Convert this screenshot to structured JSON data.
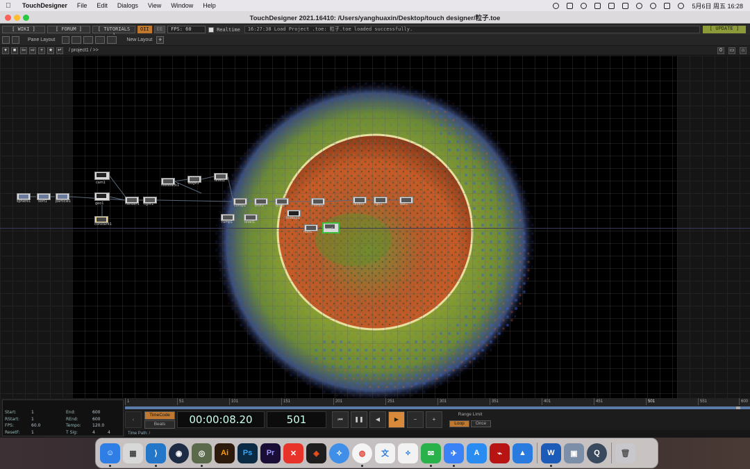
{
  "menubar": {
    "app_name": "TouchDesigner",
    "items": [
      "File",
      "Edit",
      "Dialogs",
      "View",
      "Window",
      "Help"
    ],
    "clock": "5月6日 周五  16:28"
  },
  "window": {
    "title": "TouchDesigner 2021.16410: /Users/yanghuaxin/Desktop/touch designer/粒子.toe"
  },
  "toolbar": {
    "wiki": "[ WIKI ]",
    "forum": "[ FORUM ]",
    "tutorials": "[ TUTORIALS ]",
    "oii": "OII",
    "ee": "EE",
    "fps_label": "FPS:  60",
    "realtime": "Realtime",
    "status_message": "16:27:38 Load Project .toe: 粒子.toe loaded successfully.",
    "update": "[ UPDATE ]",
    "pane_layout": "Pane Layout",
    "new_layout": "New Layout",
    "new_layout_plus": "+"
  },
  "pathbar": {
    "path": "/ project1 / >>",
    "right_value": "0"
  },
  "network": {
    "operators": [
      {
        "label": "sphere1"
      },
      {
        "label": "sort1"
      },
      {
        "label": "particle1"
      },
      {
        "label": "cam1"
      },
      {
        "label": "geo1"
      },
      {
        "label": "constant1"
      },
      {
        "label": "render1"
      },
      {
        "label": "light1"
      },
      {
        "label": "feedback1"
      },
      {
        "label": "edge1"
      },
      {
        "label": "level2"
      },
      {
        "label": "comp1"
      },
      {
        "label": "blur2"
      },
      {
        "label": "blur1"
      },
      {
        "label": "comp2"
      },
      {
        "label": "level1"
      },
      {
        "label": "ramp1"
      },
      {
        "label": "lookup1"
      },
      {
        "label": "null1"
      },
      {
        "label": "over1"
      },
      {
        "label": "level3"
      },
      {
        "label": "rgb1"
      },
      {
        "label": "out1"
      }
    ]
  },
  "timeline": {
    "info": {
      "start_label": "Start:",
      "start": "1",
      "end_label": "End:",
      "end": "600",
      "rstart_label": "RStart:",
      "rstart": "1",
      "rend_label": "REnd:",
      "rend": "600",
      "fps_label": "FPS:",
      "fps": "60.0",
      "tempo_label": "Tempo:",
      "tempo": "120.0",
      "resetf_label": "ResetF:",
      "resetf": "1",
      "tsig_label": "T Sig:",
      "tsig_a": "4",
      "tsig_b": "4"
    },
    "ruler": [
      "1",
      "51",
      "101",
      "151",
      "201",
      "251",
      "301",
      "351",
      "401",
      "451",
      "501",
      "551",
      "600"
    ],
    "timecode_btn": "TimeCode",
    "beats_btn": "Beats",
    "timecode": "00:00:08.20",
    "frame": "501",
    "range_limit": "Range Limit",
    "loop": "Loop",
    "once": "Once",
    "time_path": "Time Path: /"
  },
  "dock": {
    "apps": [
      {
        "name": "finder",
        "color": "#2f7ee6",
        "glyph": "☺"
      },
      {
        "name": "launchpad",
        "color": "#d8d8d8",
        "glyph": "▦"
      },
      {
        "name": "vscode",
        "color": "#2477c8",
        "glyph": "⟩"
      },
      {
        "name": "cinema4d",
        "color": "#1e2b44",
        "glyph": "◉"
      },
      {
        "name": "touchdesigner",
        "color": "#5a6a4a",
        "glyph": "◎"
      },
      {
        "name": "illustrator",
        "color": "#2c1a0c",
        "glyph": "Ai"
      },
      {
        "name": "photoshop",
        "color": "#0b2a44",
        "glyph": "Ps"
      },
      {
        "name": "premiere",
        "color": "#1a0e36",
        "glyph": "Pr"
      },
      {
        "name": "xmind",
        "color": "#e8332b",
        "glyph": "✕"
      },
      {
        "name": "figma",
        "color": "#1e1e1e",
        "glyph": "◈"
      },
      {
        "name": "safari",
        "color": "#3f8fe8",
        "glyph": "✧"
      },
      {
        "name": "chrome",
        "color": "#f4f4f4",
        "glyph": "◍"
      },
      {
        "name": "translator",
        "color": "#f2f2f2",
        "glyph": "文"
      },
      {
        "name": "baidu-netdisk",
        "color": "#f2f2f2",
        "glyph": "⟡"
      },
      {
        "name": "wechat",
        "color": "#2ab24a",
        "glyph": "✉"
      },
      {
        "name": "feishu",
        "color": "#3b82f6",
        "glyph": "✈"
      },
      {
        "name": "app-store",
        "color": "#2a8cf0",
        "glyph": "A"
      },
      {
        "name": "acrobat",
        "color": "#b81414",
        "glyph": "⌁"
      },
      {
        "name": "lanhu",
        "color": "#2a7be0",
        "glyph": "▲"
      },
      {
        "name": "word",
        "color": "#1d5bb8",
        "glyph": "W"
      },
      {
        "name": "preview",
        "color": "#7c8ea8",
        "glyph": "▣"
      },
      {
        "name": "quicktime",
        "color": "#3a4a5e",
        "glyph": "Q"
      },
      {
        "name": "trash",
        "color": "#c8c8cc",
        "glyph": "🗑"
      }
    ]
  }
}
